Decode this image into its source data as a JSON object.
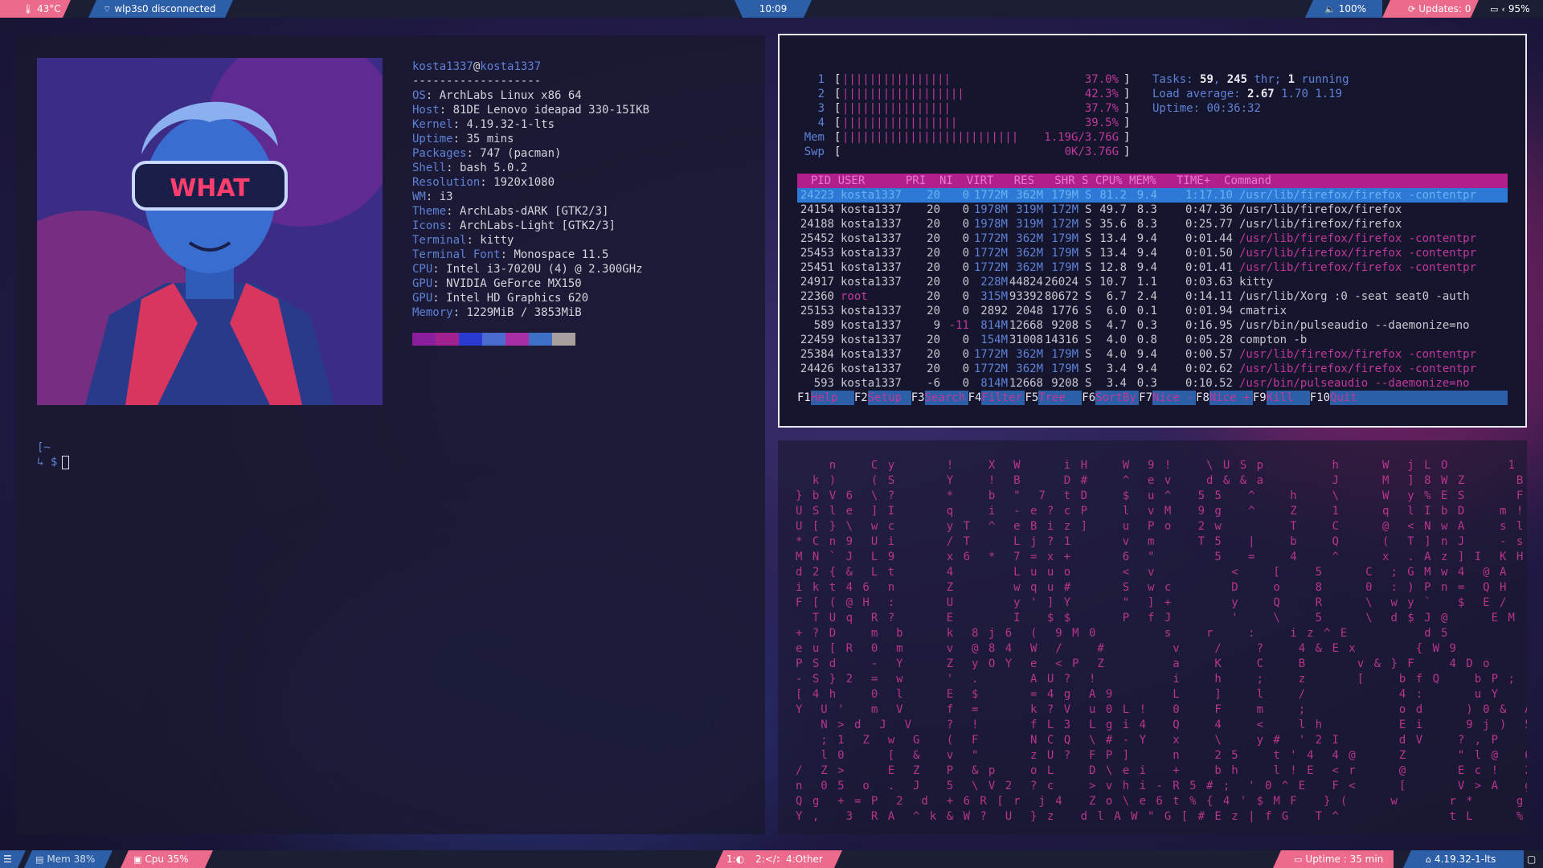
{
  "topbar": {
    "temperature": "43°C",
    "wifi": "wlp3s0 disconnected",
    "clock": "10:09",
    "volume": "100%",
    "updates": "Updates: 0",
    "battery": "95%"
  },
  "bottombar": {
    "mem": "Mem 38%",
    "cpu": "Cpu  35%",
    "workspaces": [
      "1:",
      "2:",
      "4:Other"
    ],
    "uptime": "Uptime : 35 min",
    "kernel": "4.19.32-1-lts"
  },
  "neofetch": {
    "user": "kosta1337",
    "at": "@",
    "host": "kosta1337",
    "separator": "-------------------",
    "fields": [
      {
        "key": "OS",
        "value": "ArchLabs Linux x86 64"
      },
      {
        "key": "Host",
        "value": "81DE Lenovo ideapad 330-15IKB"
      },
      {
        "key": "Kernel",
        "value": "4.19.32-1-lts"
      },
      {
        "key": "Uptime",
        "value": "35 mins"
      },
      {
        "key": "Packages",
        "value": "747 (pacman)"
      },
      {
        "key": "Shell",
        "value": "bash 5.0.2"
      },
      {
        "key": "Resolution",
        "value": "1920x1080"
      },
      {
        "key": "WM",
        "value": "i3"
      },
      {
        "key": "Theme",
        "value": "ArchLabs-dARK [GTK2/3]"
      },
      {
        "key": "Icons",
        "value": "ArchLabs-Light [GTK2/3]"
      },
      {
        "key": "Terminal",
        "value": "kitty"
      },
      {
        "key": "Terminal Font",
        "value": "Monospace 11.5"
      },
      {
        "key": "CPU",
        "value": "Intel i3-7020U (4) @ 2.300GHz"
      },
      {
        "key": "GPU",
        "value": "NVIDIA GeForce MX150"
      },
      {
        "key": "GPU",
        "value": "Intel HD Graphics 620"
      },
      {
        "key": "Memory",
        "value": "1229MiB / 3853MiB"
      }
    ],
    "palette": [
      "#8a1e9c",
      "#a3208f",
      "#2a3ad0",
      "#4a6cd0",
      "#a82ea6",
      "#3e70c8",
      "#a89f9f"
    ],
    "avatar_text": "WHAT"
  },
  "prompt": {
    "tilde": "~",
    "symbol": "$"
  },
  "htop": {
    "cpus": [
      {
        "label": "1",
        "bars": "||||||||||||||||",
        "pct": "37.0%"
      },
      {
        "label": "2",
        "bars": "||||||||||||||||||",
        "pct": "42.3%"
      },
      {
        "label": "3",
        "bars": "||||||||||||||||",
        "pct": "37.7%"
      },
      {
        "label": "4",
        "bars": "|||||||||||||||||",
        "pct": "39.5%"
      }
    ],
    "mem": {
      "label": "Mem",
      "bars": "||||||||||||||||||||||||||",
      "value": "1.19G/3.76G"
    },
    "swp": {
      "label": "Swp",
      "bars": "",
      "value": "0K/3.76G"
    },
    "tasks_label": "Tasks:",
    "tasks": "59",
    "thr": "245",
    "thr_label": "thr;",
    "running": "1",
    "running_label": "running",
    "load_label": "Load average:",
    "load": [
      "2.67",
      "1.70",
      "1.19"
    ],
    "uptime_label": "Uptime:",
    "uptime": "00:36:32",
    "header": "  PID USER      PRI  NI  VIRT   RES   SHR S CPU% MEM%   TIME+  Command",
    "rows": [
      {
        "pid": "24223",
        "user": "kosta1337",
        "pri": "20",
        "ni": "0",
        "virt": "1772M",
        "res": "362M",
        "shr": "179M",
        "s": "S",
        "cpu": "81.2",
        "mem": "9.4",
        "time": "1:17.10",
        "cmd": "/usr/lib/firefox/firefox -contentpr"
      },
      {
        "pid": "24154",
        "user": "kosta1337",
        "pri": "20",
        "ni": "0",
        "virt": "1978M",
        "res": "319M",
        "shr": "172M",
        "s": "S",
        "cpu": "49.7",
        "mem": "8.3",
        "time": "0:47.36",
        "cmd": "/usr/lib/firefox/firefox"
      },
      {
        "pid": "24188",
        "user": "kosta1337",
        "pri": "20",
        "ni": "0",
        "virt": "1978M",
        "res": "319M",
        "shr": "172M",
        "s": "S",
        "cpu": "35.6",
        "mem": "8.3",
        "time": "0:25.77",
        "cmd": "/usr/lib/firefox/firefox"
      },
      {
        "pid": "25452",
        "user": "kosta1337",
        "pri": "20",
        "ni": "0",
        "virt": "1772M",
        "res": "362M",
        "shr": "179M",
        "s": "S",
        "cpu": "13.4",
        "mem": "9.4",
        "time": "0:01.44",
        "cmd": "/usr/lib/firefox/firefox -contentpr"
      },
      {
        "pid": "25453",
        "user": "kosta1337",
        "pri": "20",
        "ni": "0",
        "virt": "1772M",
        "res": "362M",
        "shr": "179M",
        "s": "S",
        "cpu": "13.4",
        "mem": "9.4",
        "time": "0:01.50",
        "cmd": "/usr/lib/firefox/firefox -contentpr"
      },
      {
        "pid": "25451",
        "user": "kosta1337",
        "pri": "20",
        "ni": "0",
        "virt": "1772M",
        "res": "362M",
        "shr": "179M",
        "s": "S",
        "cpu": "12.8",
        "mem": "9.4",
        "time": "0:01.41",
        "cmd": "/usr/lib/firefox/firefox -contentpr"
      },
      {
        "pid": "24917",
        "user": "kosta1337",
        "pri": "20",
        "ni": "0",
        "virt": "228M",
        "res": "44824",
        "shr": "26024",
        "s": "S",
        "cpu": "10.7",
        "mem": "1.1",
        "time": "0:03.63",
        "cmd": "kitty"
      },
      {
        "pid": "22360",
        "user": "root",
        "pri": "20",
        "ni": "0",
        "virt": "315M",
        "res": "93392",
        "shr": "80672",
        "s": "S",
        "cpu": "6.7",
        "mem": "2.4",
        "time": "0:14.11",
        "cmd": "/usr/lib/Xorg :0 -seat seat0 -auth"
      },
      {
        "pid": "25153",
        "user": "kosta1337",
        "pri": "20",
        "ni": "0",
        "virt": "2892",
        "res": "2048",
        "shr": "1776",
        "s": "S",
        "cpu": "6.0",
        "mem": "0.1",
        "time": "0:01.94",
        "cmd": "cmatrix"
      },
      {
        "pid": "589",
        "user": "kosta1337",
        "pri": "9",
        "ni": "-11",
        "virt": "814M",
        "res": "12668",
        "shr": "9208",
        "s": "S",
        "cpu": "4.7",
        "mem": "0.3",
        "time": "0:16.95",
        "cmd": "/usr/bin/pulseaudio --daemonize=no"
      },
      {
        "pid": "22459",
        "user": "kosta1337",
        "pri": "20",
        "ni": "0",
        "virt": "154M",
        "res": "31008",
        "shr": "14316",
        "s": "S",
        "cpu": "4.0",
        "mem": "0.8",
        "time": "0:05.28",
        "cmd": "compton -b"
      },
      {
        "pid": "25384",
        "user": "kosta1337",
        "pri": "20",
        "ni": "0",
        "virt": "1772M",
        "res": "362M",
        "shr": "179M",
        "s": "S",
        "cpu": "4.0",
        "mem": "9.4",
        "time": "0:00.57",
        "cmd": "/usr/lib/firefox/firefox -contentpr"
      },
      {
        "pid": "24426",
        "user": "kosta1337",
        "pri": "20",
        "ni": "0",
        "virt": "1772M",
        "res": "362M",
        "shr": "179M",
        "s": "S",
        "cpu": "3.4",
        "mem": "9.4",
        "time": "0:02.62",
        "cmd": "/usr/lib/firefox/firefox -contentpr"
      },
      {
        "pid": "593",
        "user": "kosta1337",
        "pri": "-6",
        "ni": "0",
        "virt": "814M",
        "res": "12668",
        "shr": "9208",
        "s": "S",
        "cpu": "3.4",
        "mem": "0.3",
        "time": "0:10.52",
        "cmd": "/usr/bin/pulseaudio --daemonize=no"
      }
    ],
    "fkeys": [
      {
        "key": "F1",
        "label": "Help"
      },
      {
        "key": "F2",
        "label": "Setup"
      },
      {
        "key": "F3",
        "label": "Search"
      },
      {
        "key": "F4",
        "label": "Filter"
      },
      {
        "key": "F5",
        "label": "Tree"
      },
      {
        "key": "F6",
        "label": "SortBy"
      },
      {
        "key": "F7",
        "label": "Nice -"
      },
      {
        "key": "F8",
        "label": "Nice +"
      },
      {
        "key": "F9",
        "label": "Kill"
      },
      {
        "key": "F10",
        "label": "Quit"
      }
    ]
  },
  "matrix": {
    "lines": [
      "    n    C y      !    X  W     i H    W  9 !    \\ U S p        h     W  j L O       1",
      "  k )    ( S      Y    !  B     D #    ^  e v    d & & a        J     M  ] 8 W Z      B",
      "} b V 6  \\ ?      *    b  \"  7  t D    $  u ^   5 5   ^    h    \\     W  y % E S      F",
      "U S l e  ] I      q    i  - e ? c P    l  v M   9 g   ^    Z    1     q  l I b D    m !",
      "U [ } \\  w c      y T  ^  e B i z ]    u  P o   2 w        T    C     @  < N w A    s l",
      "* C n 9  U i      / T     L j ? 1      v  m     T 5   |    b    Q     (  T ] n J    - s",
      "M N ` J  L 9      x 6  *  7 = x +      6  \"       5   =    4    ^     x  . A z ] I  K H",
      "d 2 { &  L t      4       L u u o      <  v         <    [    5     C  ; G M w 4  @ A",
      "i k t 4 6  n      Z       w q u #      S  w c       D    o    8     0  : ) P n =  Q H",
      "F [ ( @ H  :      U       y ' ] Y      \"  ] +       y    Q    R     \\  w y `   $  E /",
      "  T U q  R ?      E       I   $ $      P  f J       '    \\    5     \\  d $ J @     E M",
      "+ ? D    m  b     k  8 j 6  (  9 M 0        s    r    :    i z ^ E         d 5",
      "e u [ R  0  m     v  @ 8 4  W  /    #        v    /    ?    4 & E x       { W 9",
      "P S d    -  Y     Z  y O Y  e  < P  Z        a    K    C    B      v & } F    4 D o",
      "- S } 2  =  w     '  .      A U ?  !         i    h    ;    z      [    b f Q    b P ;",
      "[ 4 h    0  l     E  $      = 4 g  A 9       L    ]    l    /           4 :      u Y",
      "Y  U '   m  V     f  =      k ? V  u 0 L !   0    F    m    ;           o d     ) 0 &  A",
      "   N > d  J  V    ?  !      f L 3  L g i 4   Q    4    <    l h         E i     9 j )  5",
      "   ; 1  Z  w  G   (  F      N C Q  \\ # - Y   x    \\    y #  ' 2 I       d V    ? , P   .",
      "   l 0     [  &   v  \"      z U ?  F P ]     n    2 5    t ' 4  4 @     Z      \" l @   6",
      "/  Z >     E  Z   P  & p    o L    D \\ e i   +    b h    l ! E  < r     @      E c !   2",
      "n  0 5  o  .  J   5  \\ V 2  ? c    > v h i - R 5 # ;  ' 0 ^ E   F <     [      V > A   g",
      "Q g  + = P  2  d  + 6 R [ r  j 4   Z o \\ e 6 t % { 4 ' $ M F   } (     w      r *     g",
      "Y ,   3  R A  ^ k & W ?  U  } z   d l A W \" G [ # E z | f G   T ^             t L     %"
    ]
  }
}
